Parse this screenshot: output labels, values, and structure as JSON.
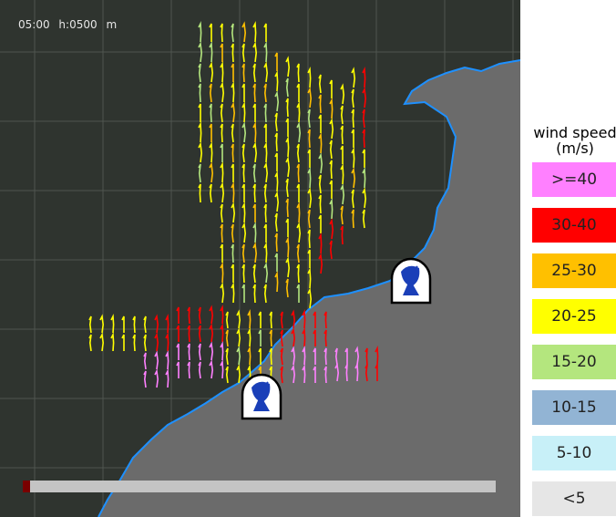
{
  "header": {
    "time": "05:00",
    "height": "h:0500",
    "unit": "m"
  },
  "legend": {
    "title_line1": "wind speed",
    "title_line2": "(m/s)",
    "items": [
      {
        "label": ">=40",
        "color": "#ff80ff"
      },
      {
        "label": "30-40",
        "color": "#ff0000"
      },
      {
        "label": "25-30",
        "color": "#ffc000"
      },
      {
        "label": "20-25",
        "color": "#ffff00"
      },
      {
        "label": "15-20",
        "color": "#b4e67e"
      },
      {
        "label": "10-15",
        "color": "#92b4d4"
      },
      {
        "label": "5-10",
        "color": "#c8f0f8"
      },
      {
        "label": "<5",
        "color": "#e6e6e6"
      }
    ]
  },
  "map": {
    "land_color": "#6b6b6b",
    "sea_color": "#2f342f",
    "coast_color": "#1e90ff",
    "grid_color": "#4f554f"
  },
  "timeline": {
    "progress": 0.015
  },
  "radars": [
    {
      "name": "radar-site-north",
      "icon": "radar-dish-icon"
    },
    {
      "name": "radar-site-south",
      "icon": "radar-dish-icon"
    }
  ]
}
